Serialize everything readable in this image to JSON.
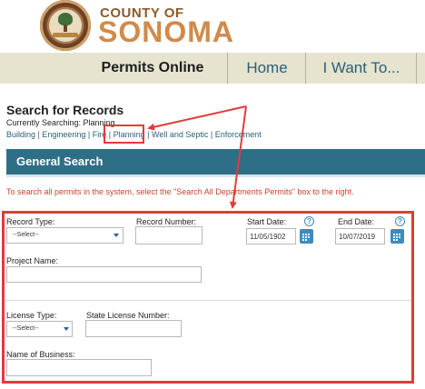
{
  "header": {
    "county_of": "COUNTY OF",
    "sonoma": "SONOMA"
  },
  "nav": {
    "permits_online": "Permits Online",
    "home": "Home",
    "i_want_to": "I Want To..."
  },
  "search": {
    "title": "Search for Records",
    "currently_searching": "Currently Searching: Planning",
    "modules": [
      "Building",
      "Engineering",
      "Fire",
      "Planning",
      "Well and Septic",
      "Enforcement"
    ],
    "separator": " | "
  },
  "general_search": {
    "title": "General Search",
    "instruction": "To search all permits in the system, select the \"Search All Departments Permits\" box to the right."
  },
  "form": {
    "record_type_label": "Record Type:",
    "record_type_value": "--Select--",
    "record_number_label": "Record Number:",
    "start_date_label": "Start Date:",
    "start_date_value": "11/05/1902",
    "end_date_label": "End Date:",
    "end_date_value": "10/07/2019",
    "help_glyph": "?",
    "project_name_label": "Project Name:",
    "license_type_label": "License Type:",
    "license_type_value": "--Select--",
    "state_license_label": "State License Number:",
    "business_name_label": "Name of Business:"
  },
  "colors": {
    "accent_blue": "#2e6f87",
    "highlight_red": "#e23b3b",
    "instruction_orange": "#c8452c",
    "nav_bg": "#e6e3cf"
  },
  "icons": {
    "seal": "county-seal-icon",
    "help": "help-circle-icon",
    "calendar": "calendar-icon",
    "dropdown": "chevron-down-icon"
  }
}
